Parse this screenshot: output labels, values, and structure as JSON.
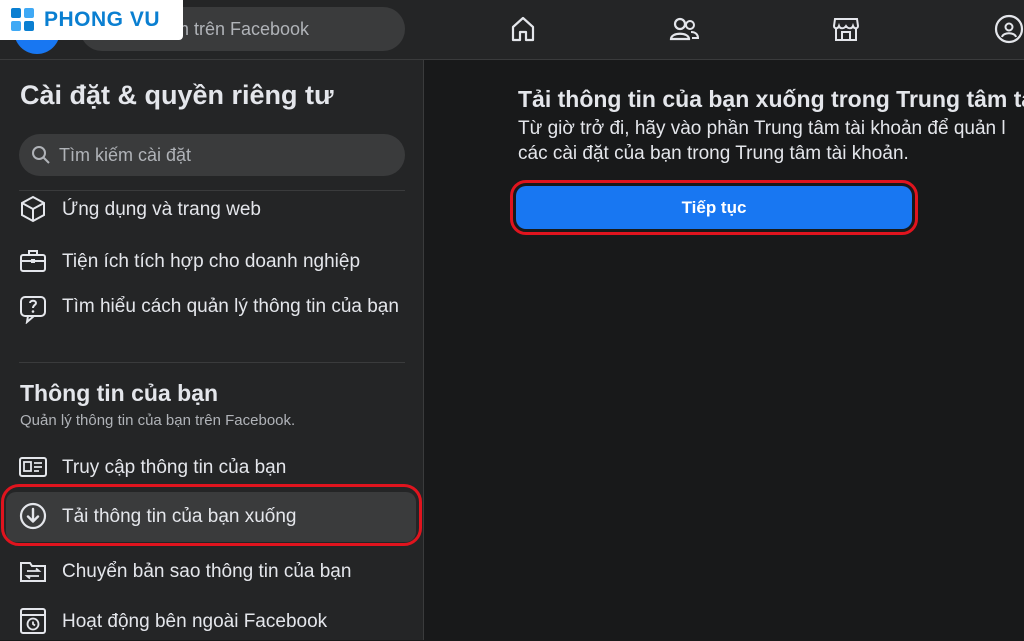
{
  "watermark": {
    "brand": "PHONG VU"
  },
  "topbar": {
    "search_placeholder_partial": "m trên Facebook",
    "nav_icons": [
      "home-icon",
      "friends-icon",
      "marketplace-icon",
      "groups-icon"
    ]
  },
  "sidebar": {
    "title": "Cài đặt & quyền riêng tư",
    "search_placeholder": "Tìm kiếm cài đặt",
    "items_top": [
      {
        "label": "Ứng dụng và trang web",
        "icon": "cube-icon"
      },
      {
        "label": "Tiện ích tích hợp cho doanh nghiệp",
        "icon": "briefcase-icon"
      },
      {
        "label": "Tìm hiểu cách quản lý thông tin của bạn",
        "icon": "question-bubble-icon"
      }
    ],
    "section": {
      "heading": "Thông tin của bạn",
      "subtitle": "Quản lý thông tin của bạn trên Facebook.",
      "items": [
        {
          "label": "Truy cập thông tin của bạn",
          "icon": "id-card-icon"
        },
        {
          "label": "Tải thông tin của bạn xuống",
          "icon": "download-circle-icon",
          "active": true
        },
        {
          "label": "Chuyển bản sao thông tin của bạn",
          "icon": "folder-transfer-icon"
        },
        {
          "label": "Hoạt động bên ngoài Facebook",
          "icon": "history-icon"
        }
      ]
    }
  },
  "main": {
    "title": "Tải thông tin của bạn xuống trong Trung tâm tà",
    "desc_line1": "Từ giờ trở đi, hãy vào phần Trung tâm tài khoản để quản l",
    "desc_line2": "các cài đặt của bạn trong Trung tâm tài khoản.",
    "continue_label": "Tiếp tục"
  },
  "colors": {
    "background": "#18191a",
    "panel": "#242526",
    "accent": "#1877f2",
    "highlight": "#e0141e",
    "text": "#e4e6eb",
    "muted": "#b0b3b8"
  }
}
